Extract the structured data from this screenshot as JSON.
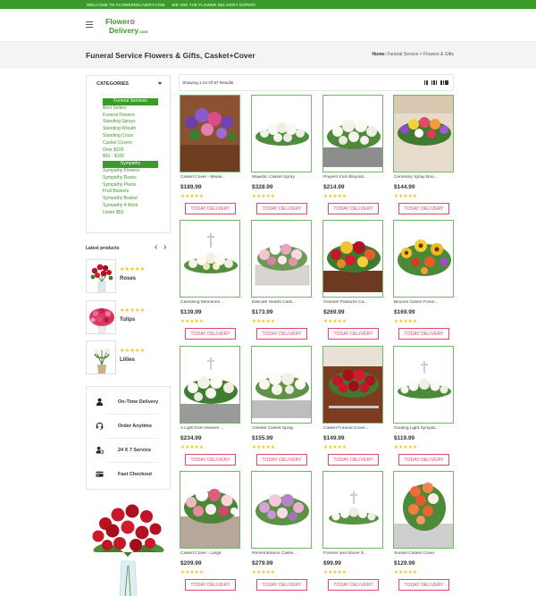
{
  "topbar": {
    "msg1": "WELCOME TO FLOWERDELIVERY.COM",
    "msg2": "WE ARE THE FLOWER DELIVERY EXPERT."
  },
  "logo": {
    "line1": "Flower",
    "line2": "Delivery",
    "suffix": ".com"
  },
  "page_title": "Funeral Service Flowers & Gifts, Casket+Cover",
  "breadcrumb": {
    "home": "Home:",
    "path": " Funeral Service > Flowers & Gifts"
  },
  "categories": {
    "title": "CATEGORIES",
    "items": [
      {
        "label": "Funeral Services",
        "active": true
      },
      {
        "label": "Best Sellers"
      },
      {
        "label": "Funeral Flowers"
      },
      {
        "label": "Standing Sprays"
      },
      {
        "label": "Standing Wreath"
      },
      {
        "label": "Standing Cross"
      },
      {
        "label": "Casket Covers"
      },
      {
        "label": "Over $100"
      },
      {
        "label": "$50 - $100"
      },
      {
        "label": "Sympathy",
        "active": true
      },
      {
        "label": "Sympathy Flowers"
      },
      {
        "label": "Sympathy Roses"
      },
      {
        "label": "Sympathy Plants"
      },
      {
        "label": "Fruit Baskets"
      },
      {
        "label": "Sympathy Basket"
      },
      {
        "label": "Sympathy 4 Work"
      },
      {
        "label": "Under $50"
      }
    ]
  },
  "latest": {
    "title": "Latest products",
    "items": [
      {
        "name": "Roses",
        "stars": "★★★★★"
      },
      {
        "name": "Tulips",
        "stars": "★★★★★"
      },
      {
        "name": "Lillies",
        "stars": "★★★★★"
      }
    ]
  },
  "features": [
    {
      "label": "On-Time Delivery",
      "icon": "person-icon"
    },
    {
      "label": "Order Anytime",
      "icon": "headset-icon"
    },
    {
      "label": "24 X 7 Service",
      "icon": "user-clock-icon"
    },
    {
      "label": "Fast Checkout",
      "icon": "credit-card-icon"
    }
  ],
  "results": {
    "text": "Showing 1-24 Of 57 Results"
  },
  "products": [
    {
      "name": "Casket Cover - Mediu...",
      "price": "$189.99",
      "stars": "★★★★★",
      "button": "TODAY DELIVERY"
    },
    {
      "name": "Majestic Casket Spray",
      "price": "$328.99",
      "stars": "★★★★★",
      "button": "TODAY DELIVERY"
    },
    {
      "name": "Prayers from Beyond...",
      "price": "$214.99",
      "stars": "★★★★★",
      "button": "TODAY DELIVERY"
    },
    {
      "name": "Cemetary Spray Bou...",
      "price": "$144.99",
      "stars": "★★★★★",
      "button": "TODAY DELIVERY"
    },
    {
      "name": "Caressing Memories ...",
      "price": "$139.99",
      "stars": "★★★★★",
      "button": "TODAY DELIVERY"
    },
    {
      "name": "Delicate Hearts Cask...",
      "price": "$173.99",
      "stars": "★★★★★",
      "button": "TODAY DELIVERY"
    },
    {
      "name": "Greener Pastures Ca...",
      "price": "$269.99",
      "stars": "★★★★★",
      "button": "TODAY DELIVERY"
    },
    {
      "name": "Blooms Galore Funer...",
      "price": "$169.99",
      "stars": "★★★★★",
      "button": "TODAY DELIVERY"
    },
    {
      "name": "A Light from Heaven ...",
      "price": "$234.99",
      "stars": "★★★★★",
      "button": "TODAY DELIVERY"
    },
    {
      "name": "Celeste Casket Spray",
      "price": "$155.99",
      "stars": "★★★★★",
      "button": "TODAY DELIVERY"
    },
    {
      "name": "Casket Funeral Cover...",
      "price": "$149.99",
      "stars": "★★★★★",
      "button": "TODAY DELIVERY"
    },
    {
      "name": "Guiding Light Sympat...",
      "price": "$119.99",
      "stars": "★★★★★",
      "button": "TODAY DELIVERY"
    },
    {
      "name": "Casket Cover - Large",
      "price": "$209.99",
      "stars": "★★★★★",
      "button": "TODAY DELIVERY"
    },
    {
      "name": "Remembrance Caske...",
      "price": "$279.99",
      "stars": "★★★★★",
      "button": "TODAY DELIVERY"
    },
    {
      "name": "Forever and Above S...",
      "price": "$99.99",
      "stars": "★★★★★",
      "button": "TODAY DELIVERY"
    },
    {
      "name": "Sunset Casket Cover",
      "price": "$129.99",
      "stars": "★★★★★",
      "button": "TODAY DELIVERY"
    }
  ],
  "colors": {
    "brand_green": "#3c9a2b",
    "accent_pink": "#e2486b",
    "star": "#f3c20c"
  }
}
